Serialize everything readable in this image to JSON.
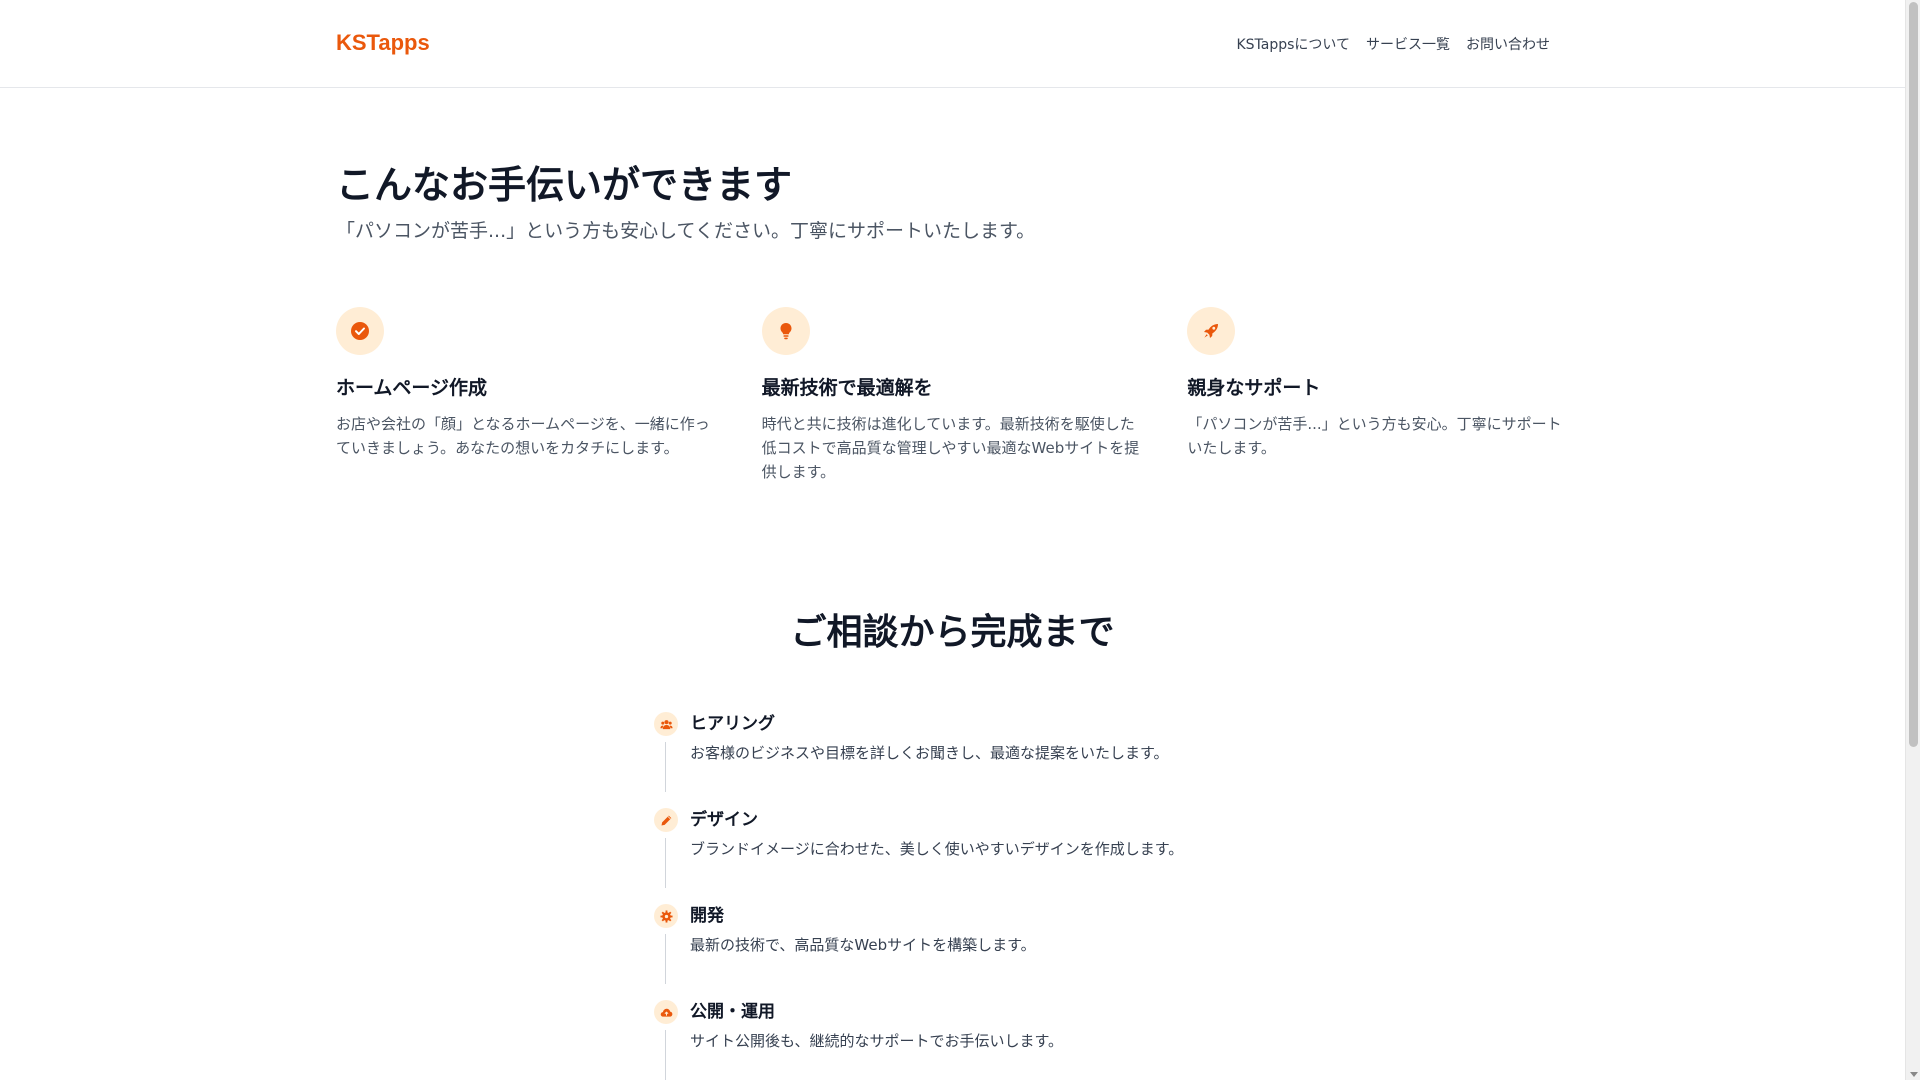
{
  "header": {
    "brand": "KSTapps",
    "nav": [
      {
        "label": "KSTappsについて"
      },
      {
        "label": "サービス一覧"
      },
      {
        "label": "お問い合わせ"
      }
    ]
  },
  "services": {
    "title": "こんなお手伝いができます",
    "subtitle": "「パソコンが苦手...」という方も安心してください。丁寧にサポートいたします。",
    "cards": [
      {
        "icon": "check-circle-icon",
        "title": "ホームページ作成",
        "text": "お店や会社の「顔」となるホームページを、一緒に作っていきましょう。あなたの想いをカタチにします。"
      },
      {
        "icon": "lightbulb-icon",
        "title": "最新技術で最適解を",
        "text": "時代と共に技術は進化しています。最新技術を駆使した低コストで高品質な管理しやすい最適なWebサイトを提供します。"
      },
      {
        "icon": "rocket-icon",
        "title": "親身なサポート",
        "text": "「パソコンが苦手...」という方も安心。丁寧にサポートいたします。"
      }
    ]
  },
  "process": {
    "title": "ご相談から完成まで",
    "steps": [
      {
        "icon": "users-icon",
        "title": "ヒアリング",
        "text": "お客様のビジネスや目標を詳しくお聞きし、最適な提案をいたします。"
      },
      {
        "icon": "pencil-icon",
        "title": "デザイン",
        "text": "ブランドイメージに合わせた、美しく使いやすいデザインを作成します。"
      },
      {
        "icon": "gear-icon",
        "title": "開発",
        "text": "最新の技術で、高品質なWebサイトを構築します。"
      },
      {
        "icon": "cloud-upload-icon",
        "title": "公開・運用",
        "text": "サイト公開後も、継続的なサポートでお手伝いします。"
      }
    ]
  },
  "colors": {
    "accent": "#ea580c",
    "icon_bg": "#ffedd5"
  }
}
